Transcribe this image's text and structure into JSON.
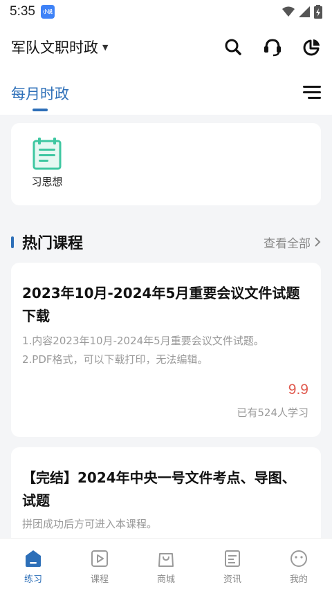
{
  "status_bar": {
    "time": "5:35",
    "app_badge_text": "小说"
  },
  "top_bar": {
    "title": "军队文职时政",
    "icons": [
      "search-icon",
      "headset-icon",
      "pie-chart-icon"
    ]
  },
  "tab_bar": {
    "active_tab": "每月时政",
    "menu_icon": "menu-icon"
  },
  "categories": [
    {
      "label": "习思想",
      "icon": "notepad-icon"
    }
  ],
  "section": {
    "title": "热门课程",
    "more_label": "查看全部"
  },
  "courses": [
    {
      "title": "2023年10月-2024年5月重要会议文件试题下载",
      "desc_lines": [
        "1.内容2023年10月-2024年5月重要会议文件试题。",
        "2.PDF格式，可以下载打印，无法编辑。"
      ],
      "price": "9.9",
      "learners": "已有524人学习"
    },
    {
      "title": "【完结】2024年中央一号文件考点、导图、试题",
      "desc_lines": [
        "拼团成功后方可进入本课程。"
      ]
    }
  ],
  "bottom_nav": [
    {
      "label": "练习",
      "icon": "practice-icon",
      "active": true
    },
    {
      "label": "课程",
      "icon": "course-icon",
      "active": false
    },
    {
      "label": "商城",
      "icon": "shop-bag-icon",
      "active": false
    },
    {
      "label": "资讯",
      "icon": "news-icon",
      "active": false
    },
    {
      "label": "我的",
      "icon": "profile-icon",
      "active": false
    }
  ],
  "colors": {
    "accent": "#2d6fb8",
    "price": "#e05a4f",
    "icon_green": "#3ec7a1",
    "background": "#f4f5f7"
  }
}
